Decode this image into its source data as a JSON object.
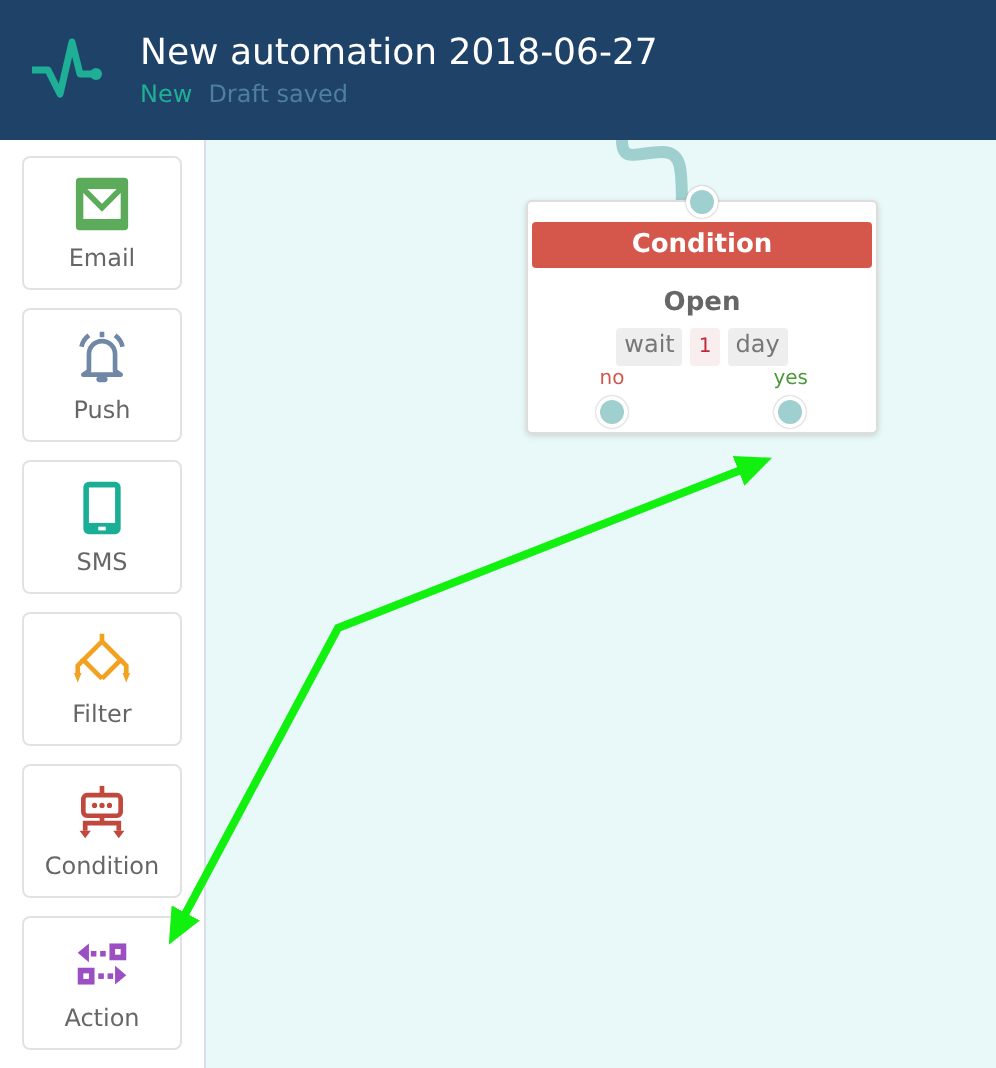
{
  "header": {
    "title": "New automation 2018-06-27",
    "status": "New",
    "save_state": "Draft saved"
  },
  "palette": [
    {
      "kind": "email",
      "label": "Email"
    },
    {
      "kind": "push",
      "label": "Push"
    },
    {
      "kind": "sms",
      "label": "SMS"
    },
    {
      "kind": "filter",
      "label": "Filter"
    },
    {
      "kind": "condition",
      "label": "Condition"
    },
    {
      "kind": "action",
      "label": "Action"
    }
  ],
  "node": {
    "title": "Condition",
    "event": "Open",
    "wait": [
      "wait",
      "1",
      "day"
    ],
    "outputs": [
      {
        "label": "no",
        "kind": "no"
      },
      {
        "label": "yes",
        "kind": "yes"
      }
    ]
  }
}
